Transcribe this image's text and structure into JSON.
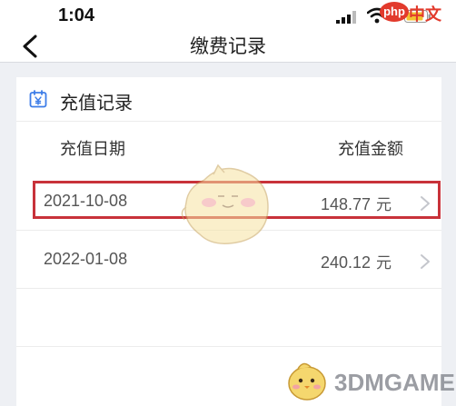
{
  "status_bar": {
    "time": "1:04",
    "icons": [
      "signal-icon",
      "wifi-icon",
      "battery-icon"
    ]
  },
  "watermark_top": {
    "logo_text": "php",
    "text": "中文网"
  },
  "nav": {
    "title": "缴费记录",
    "back_icon": "chevron-left-icon"
  },
  "card": {
    "title": "充值记录",
    "icon": "calendar-yuan-icon",
    "columns": {
      "date": "充值日期",
      "amount": "充值金额"
    },
    "rows": [
      {
        "date": "2021-10-08",
        "amount": "148.77",
        "unit": "元",
        "highlighted": true
      },
      {
        "date": "2022-01-08",
        "amount": "240.12",
        "unit": "元",
        "highlighted": false
      }
    ]
  },
  "watermark_bottom": {
    "text": "3DMGAME"
  },
  "colors": {
    "background": "#eef0f4",
    "card": "#ffffff",
    "highlight_border": "#c8323a",
    "icon_accent": "#3d7de8",
    "text_secondary": "#555555"
  }
}
